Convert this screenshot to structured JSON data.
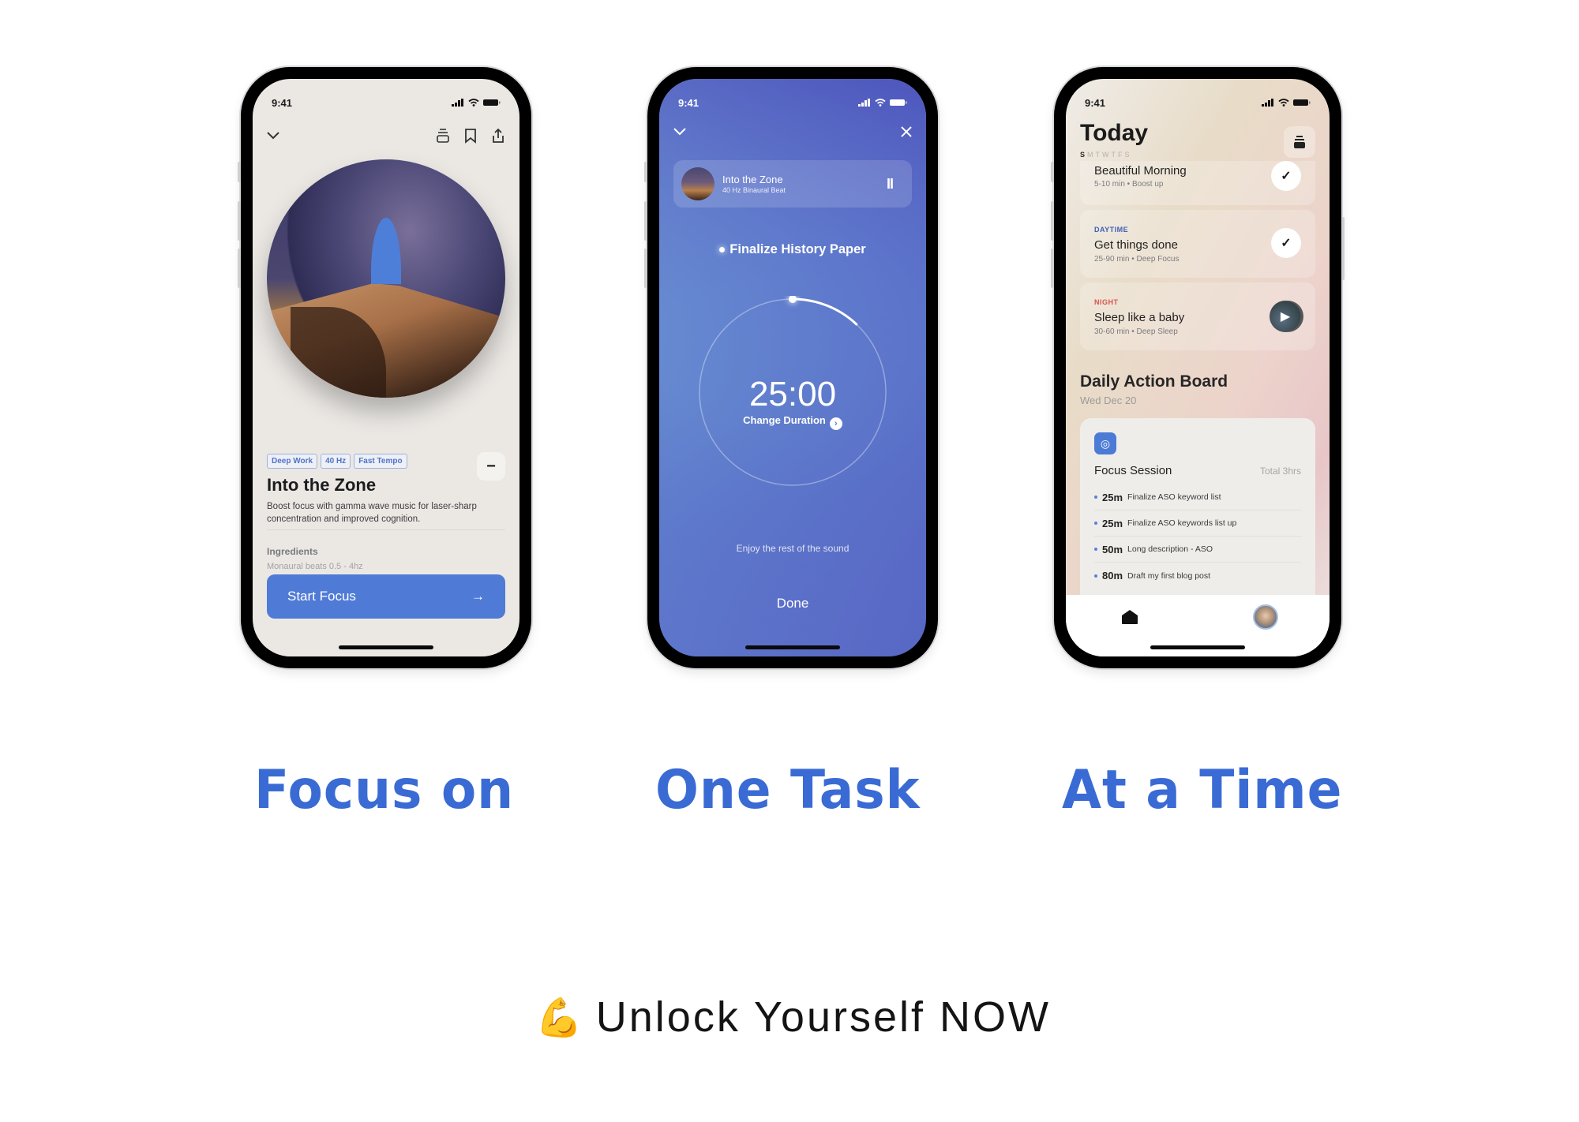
{
  "status_bar": {
    "time": "9:41"
  },
  "phone1": {
    "tags": [
      "Deep Work",
      "40 Hz",
      "Fast Tempo"
    ],
    "collapse_symbol": "−",
    "title": "Into the Zone",
    "description": "Boost focus with gamma wave music for laser-sharp concentration and improved cognition.",
    "ingredients_label": "Ingredients",
    "ingredients_value": "Monaural beats 0.5 - 4hz",
    "start_button": "Start Focus",
    "start_arrow": "→"
  },
  "phone2": {
    "now_playing": {
      "title": "Into the Zone",
      "subtitle": "40 Hz Binaural Beat",
      "pause_symbol": "II"
    },
    "task": "Finalize History Paper",
    "timer": "25:00",
    "timer_progress_fraction": 0.12,
    "change_duration": "Change Duration",
    "change_chevron": "›",
    "enjoy_text": "Enjoy the rest of the sound",
    "done_button": "Done",
    "colors": {
      "gradient_top": "#5359bf",
      "gradient_bottom": "#7aa9d6"
    }
  },
  "phone3": {
    "title": "Today",
    "weekdays": [
      "S",
      "M",
      "T",
      "W",
      "T",
      "F",
      "S"
    ],
    "routines": [
      {
        "period": "",
        "name": "Beautiful Morning",
        "meta": "5-10 min • Boost up",
        "state": "done"
      },
      {
        "period": "DAYTIME",
        "period_color": "#3f5fb8",
        "name": "Get things done",
        "meta": "25-90 min • Deep Focus",
        "state": "done"
      },
      {
        "period": "NIGHT",
        "period_color": "#d9534f",
        "name": "Sleep like a baby",
        "meta": "30-60 min • Deep Sleep",
        "state": "play"
      }
    ],
    "check_symbol": "✓",
    "play_symbol": "▶",
    "board_title": "Daily Action Board",
    "board_date": "Wed Dec 20",
    "session_title": "Focus Session",
    "session_total": "Total 3hrs",
    "session_items": [
      {
        "duration": "25m",
        "task": "Finalize ASO keyword list"
      },
      {
        "duration": "25m",
        "task": "Finalize ASO keywords list up"
      },
      {
        "duration": "50m",
        "task": "Long description - ASO"
      },
      {
        "duration": "80m",
        "task": "Draft my first blog post"
      }
    ]
  },
  "headlines": [
    "Focus on",
    "One Task",
    "At a Time"
  ],
  "cta": {
    "emoji": "💪",
    "text": "Unlock Yourself NOW"
  },
  "colors": {
    "accent": "#3a6bd4",
    "button": "#4f7bd6"
  }
}
